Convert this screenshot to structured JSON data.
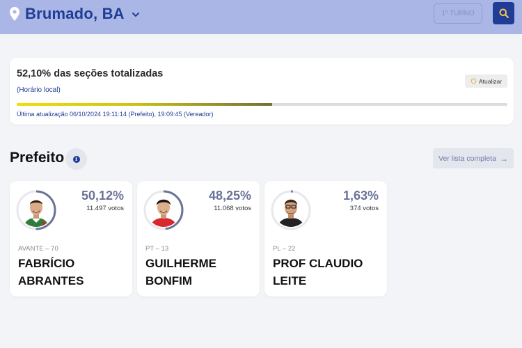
{
  "header": {
    "city": "Brumado, BA",
    "turno_label": "1º TURNO"
  },
  "status": {
    "percent_text": "52,10% das seções totalizadas",
    "local_time_label": "(Horário local)",
    "refresh_label": "Atualizar",
    "progress_fraction": 0.521,
    "last_update": "Última atualização 06/10/2024 19:11:14 (Prefeito), 19:09:45 (Vereador)"
  },
  "section": {
    "title": "Prefeito",
    "list_button": "Ver lista completa"
  },
  "candidates": [
    {
      "percent": "50,12%",
      "votes": "11.497 votos",
      "party": "AVANTE – 70",
      "name": "FABRÍCIO ABRANTES",
      "share": 0.5012
    },
    {
      "percent": "48,25%",
      "votes": "11.068 votos",
      "party": "PT – 13",
      "name": "GUILHERME BONFIM",
      "share": 0.4825
    },
    {
      "percent": "1,63%",
      "votes": "374 votos",
      "party": "PL – 22",
      "name": "PROF CLAUDIO LEITE",
      "share": 0.0163
    }
  ],
  "colors": {
    "header_bg": "#aab6e6",
    "brand_blue": "#1f3c96",
    "ring": "#6a7399",
    "percent_text": "#6a7399"
  },
  "icons": [
    "location-pin-icon",
    "chevron-down-icon",
    "search-icon",
    "refresh-icon",
    "info-icon",
    "arrow-right-icon"
  ]
}
